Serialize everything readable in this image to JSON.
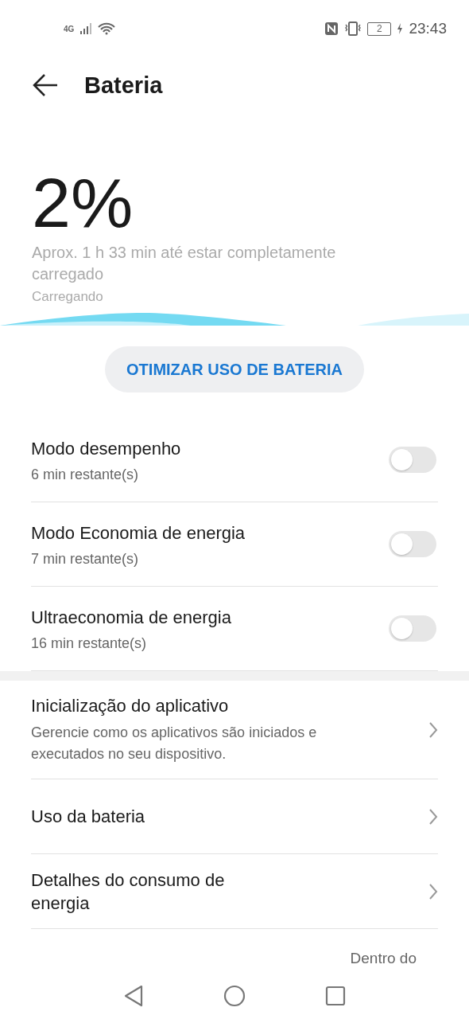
{
  "status_bar": {
    "network": "4G",
    "battery": "2",
    "time": "23:43"
  },
  "header": {
    "title": "Bateria"
  },
  "battery": {
    "percent": "2%",
    "estimate": "Aprox. 1 h 33 min até estar completamente carregado",
    "state": "Carregando"
  },
  "optimize_button": "OTIMIZAR USO DE BATERIA",
  "modes": [
    {
      "title": "Modo desempenho",
      "subtitle": "6 min restante(s)",
      "on": false
    },
    {
      "title": "Modo Economia de energia",
      "subtitle": "7 min restante(s)",
      "on": false
    },
    {
      "title": "Ultraeconomia de energia",
      "subtitle": "16 min restante(s)",
      "on": false
    }
  ],
  "links": [
    {
      "title": "Inicialização do aplicativo",
      "subtitle": "Gerencie como os aplicativos são iniciados e executados no seu dispositivo."
    },
    {
      "title": "Uso da bateria"
    },
    {
      "title": "Detalhes do consumo de energia"
    }
  ],
  "footer_text": "Dentro do"
}
